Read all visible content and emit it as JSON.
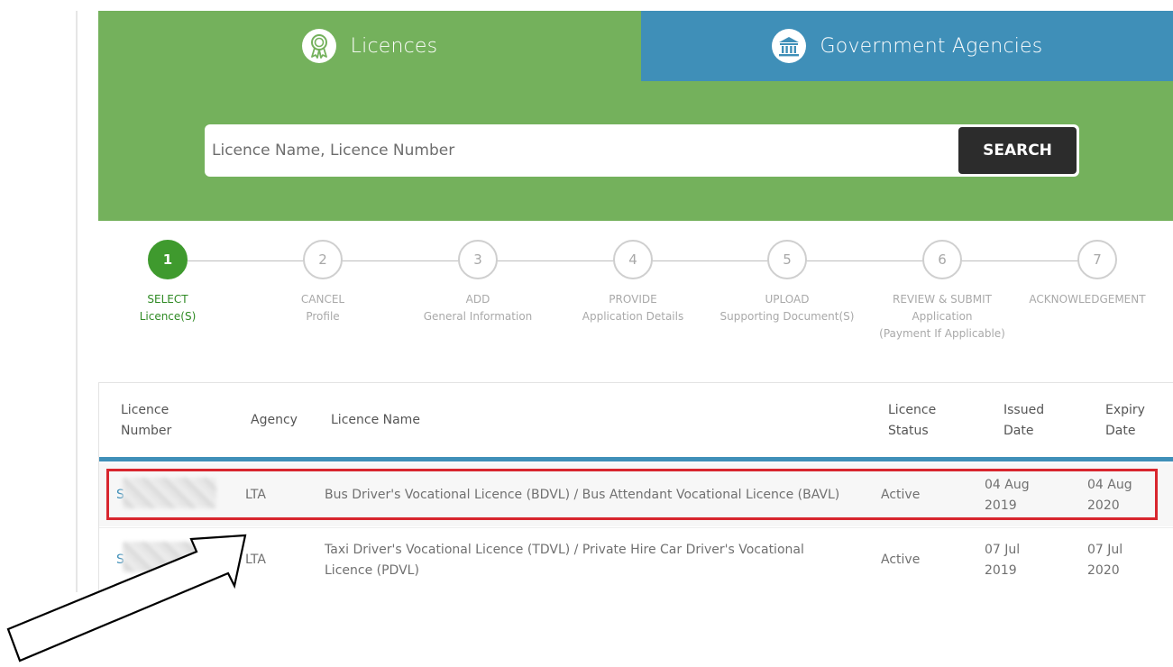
{
  "tabs": {
    "licences": {
      "label": "Licences",
      "icon": "ribbon-award-icon"
    },
    "agencies": {
      "label": "Government Agencies",
      "icon": "government-building-icon"
    }
  },
  "search": {
    "placeholder": "Licence Name, Licence Number",
    "value": "",
    "button_label": "SEARCH"
  },
  "stepper": {
    "current": 1,
    "steps": [
      {
        "number": "1",
        "lines": [
          "SELECT",
          "Licence(S)"
        ],
        "status": "active"
      },
      {
        "number": "2",
        "lines": [
          "CANCEL",
          "Profile"
        ],
        "status": "pending"
      },
      {
        "number": "3",
        "lines": [
          "ADD",
          "General Information"
        ],
        "status": "pending"
      },
      {
        "number": "4",
        "lines": [
          "PROVIDE",
          "Application Details"
        ],
        "status": "pending"
      },
      {
        "number": "5",
        "lines": [
          "UPLOAD",
          "Supporting Document(S)"
        ],
        "status": "pending"
      },
      {
        "number": "6",
        "lines": [
          "REVIEW & SUBMIT",
          "Application",
          "(Payment If Applicable)"
        ],
        "status": "pending"
      },
      {
        "number": "7",
        "lines": [
          "ACKNOWLEDGEMENT"
        ],
        "status": "pending"
      }
    ]
  },
  "table": {
    "headers": {
      "licence_number": [
        "Licence",
        "Number"
      ],
      "agency": "Agency",
      "licence_name": "Licence Name",
      "licence_status": [
        "Licence",
        "Status"
      ],
      "issued_date": [
        "Issued",
        "Date"
      ],
      "expiry_date": [
        "Expiry",
        "Date"
      ]
    },
    "rows": [
      {
        "licence_number": "S",
        "agency": "LTA",
        "licence_name": [
          "Bus Driver's Vocational Licence (BDVL) / Bus Attendant Vocational Licence (BAVL)"
        ],
        "status": "Active",
        "issued": [
          "04 Aug",
          "2019"
        ],
        "expiry": [
          "04 Aug",
          "2020"
        ]
      },
      {
        "licence_number": "S",
        "agency": "LTA",
        "licence_name": [
          "Taxi Driver's Vocational Licence (TDVL) / Private Hire Car Driver's Vocational",
          "Licence (PDVL)"
        ],
        "status": "Active",
        "issued": [
          "07 Jul",
          "2019"
        ],
        "expiry": [
          "07 Jul",
          "2020"
        ]
      }
    ]
  },
  "colors": {
    "green_panel": "#74b15c",
    "blue_tab": "#3f8fb8",
    "step_active": "#3f9a2e",
    "highlight": "#d8262e"
  }
}
